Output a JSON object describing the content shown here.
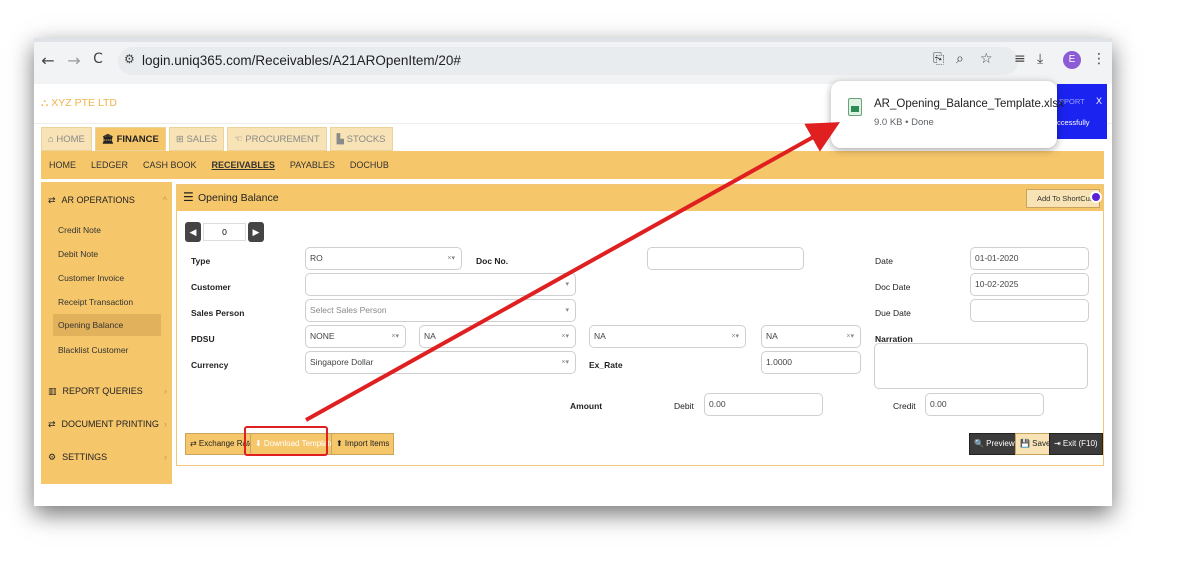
{
  "browser": {
    "url": "login.uniq365.com/Receivables/A21AROpenItem/20#",
    "profile_initial": "E",
    "nav": {
      "back": "←",
      "forward": "→",
      "reload": "C"
    }
  },
  "app": {
    "brand": "XYZ PTE LTD",
    "module_tabs": [
      "HOME",
      "FINANCE",
      "SALES",
      "PROCUREMENT",
      "STOCKS"
    ],
    "module_tab_icons": [
      "⌂",
      "🏛",
      "⊞",
      "☜",
      "▙"
    ],
    "menu": [
      "HOME",
      "LEDGER",
      "CASH BOOK",
      "RECEIVABLES",
      "PAYABLES",
      "DOCHUB"
    ],
    "sidebar": {
      "sections": [
        "AR OPERATIONS",
        "REPORT QUERIES",
        "DOCUMENT PRINTING",
        "SETTINGS"
      ],
      "items": [
        "Credit Note",
        "Debit Note",
        "Customer Invoice",
        "Receipt Transaction",
        "Opening Balance",
        "Blacklist Customer"
      ]
    }
  },
  "panel": {
    "title": "Opening Balance",
    "shortcut_label": "Add To ShortCut",
    "pager_value": "0"
  },
  "form": {
    "type_label": "Type",
    "type_value": "RO",
    "docno_label": "Doc No.",
    "docno_value": "",
    "customer_label": "Customer",
    "customer_value": "",
    "salesperson_label": "Sales Person",
    "salesperson_placeholder": "Select Sales Person",
    "pdsu_label": "PDSU",
    "pdsu_values": [
      "NONE",
      "NA",
      "NA",
      "NA"
    ],
    "currency_label": "Currency",
    "currency_value": "Singapore Dollar",
    "exrate_label": "Ex_Rate",
    "exrate_value": "1.0000",
    "date_label": "Date",
    "date_value": "01-01-2020",
    "docdate_label": "Doc Date",
    "docdate_value": "10-02-2025",
    "duedate_label": "Due Date",
    "duedate_value": "",
    "narration_label": "Narration",
    "amount_label": "Amount",
    "debit_label": "Debit",
    "debit_value": "0.00",
    "credit_label": "Credit",
    "credit_value": "0.00",
    "clear_mark": "×▾"
  },
  "buttons": {
    "exchange_rate": "⇄ Exchange Rate",
    "download_template": "⬇ Download Template",
    "import_items": "⬆ Import Items",
    "preview": "🔍 Preview",
    "save": "💾 Save",
    "exit": "⇥ Exit (F10)"
  },
  "download": {
    "filename": "AR_Opening_Balance_Template.xlsx",
    "status": "9.0 KB • Done"
  },
  "toast": {
    "partial_top": "PPORT",
    "partial_text": "ccessfully",
    "close": "X"
  },
  "colors": {
    "accent": "#f6c66b",
    "arrow": "#e02020",
    "toast": "#1a23f0"
  }
}
